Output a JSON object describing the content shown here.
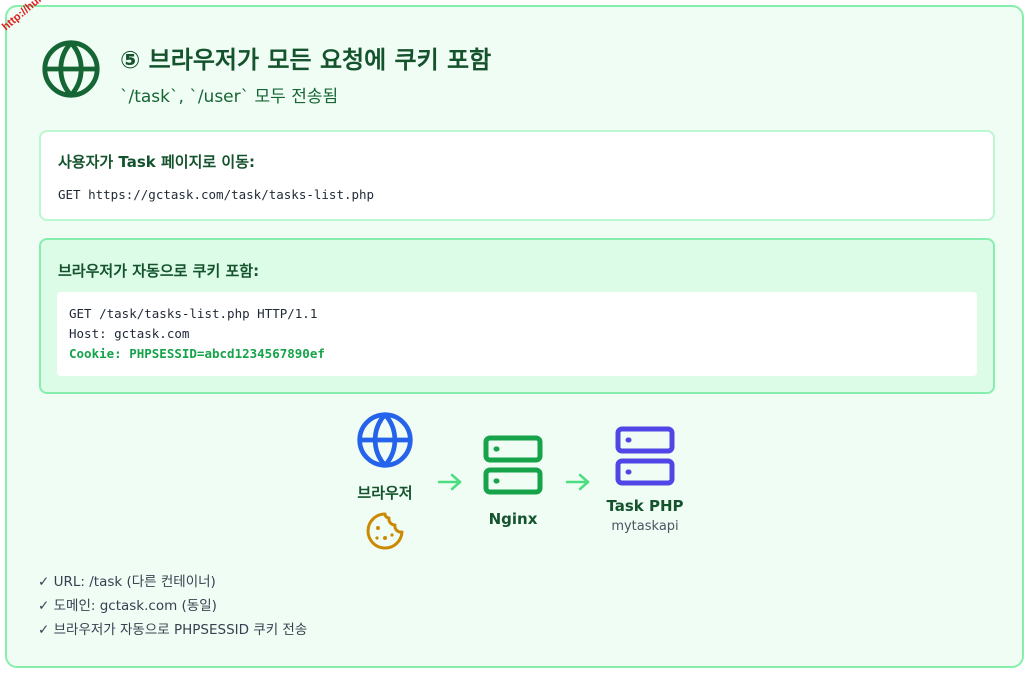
{
  "watermark": "http://hull.kr",
  "header": {
    "icon": "globe-icon",
    "title": "⑤ 브라우저가 모든 요청에 쿠키 포함",
    "subtitle": "`/task`, `/user` 모두 전송됨"
  },
  "step_box": {
    "label": "사용자가 Task 페이지로 이동:",
    "code": "GET https://gctask.com/task/tasks-list.php"
  },
  "request_box": {
    "label": "브라우저가 자동으로 쿠키 포함:",
    "lines": [
      "GET /task/tasks-list.php HTTP/1.1",
      "Host: gctask.com",
      "Cookie: PHPSESSID=abcd1234567890ef"
    ]
  },
  "flow": {
    "browser": {
      "label": "브라우저",
      "icon": "globe-icon",
      "badge_icon": "cookie-icon"
    },
    "nginx": {
      "label": "Nginx",
      "icon": "server-icon"
    },
    "task": {
      "label": "Task PHP",
      "sub": "mytaskapi",
      "icon": "server-icon"
    },
    "arrow_icon": "arrow-right-icon"
  },
  "checklist": [
    "✓ URL: /task (다른 컨테이너)",
    "✓ 도메인: gctask.com (동일)",
    "✓ 브라우저가 자동으로 PHPSESSID 쿠키 전송"
  ],
  "colors": {
    "card_bg": "#f0fdf4",
    "border": "#86efac",
    "title": "#14532d",
    "browser_blue": "#2563eb",
    "nginx_green": "#16a34a",
    "task_indigo": "#4f46e5",
    "cookie": "#ca8a04"
  }
}
